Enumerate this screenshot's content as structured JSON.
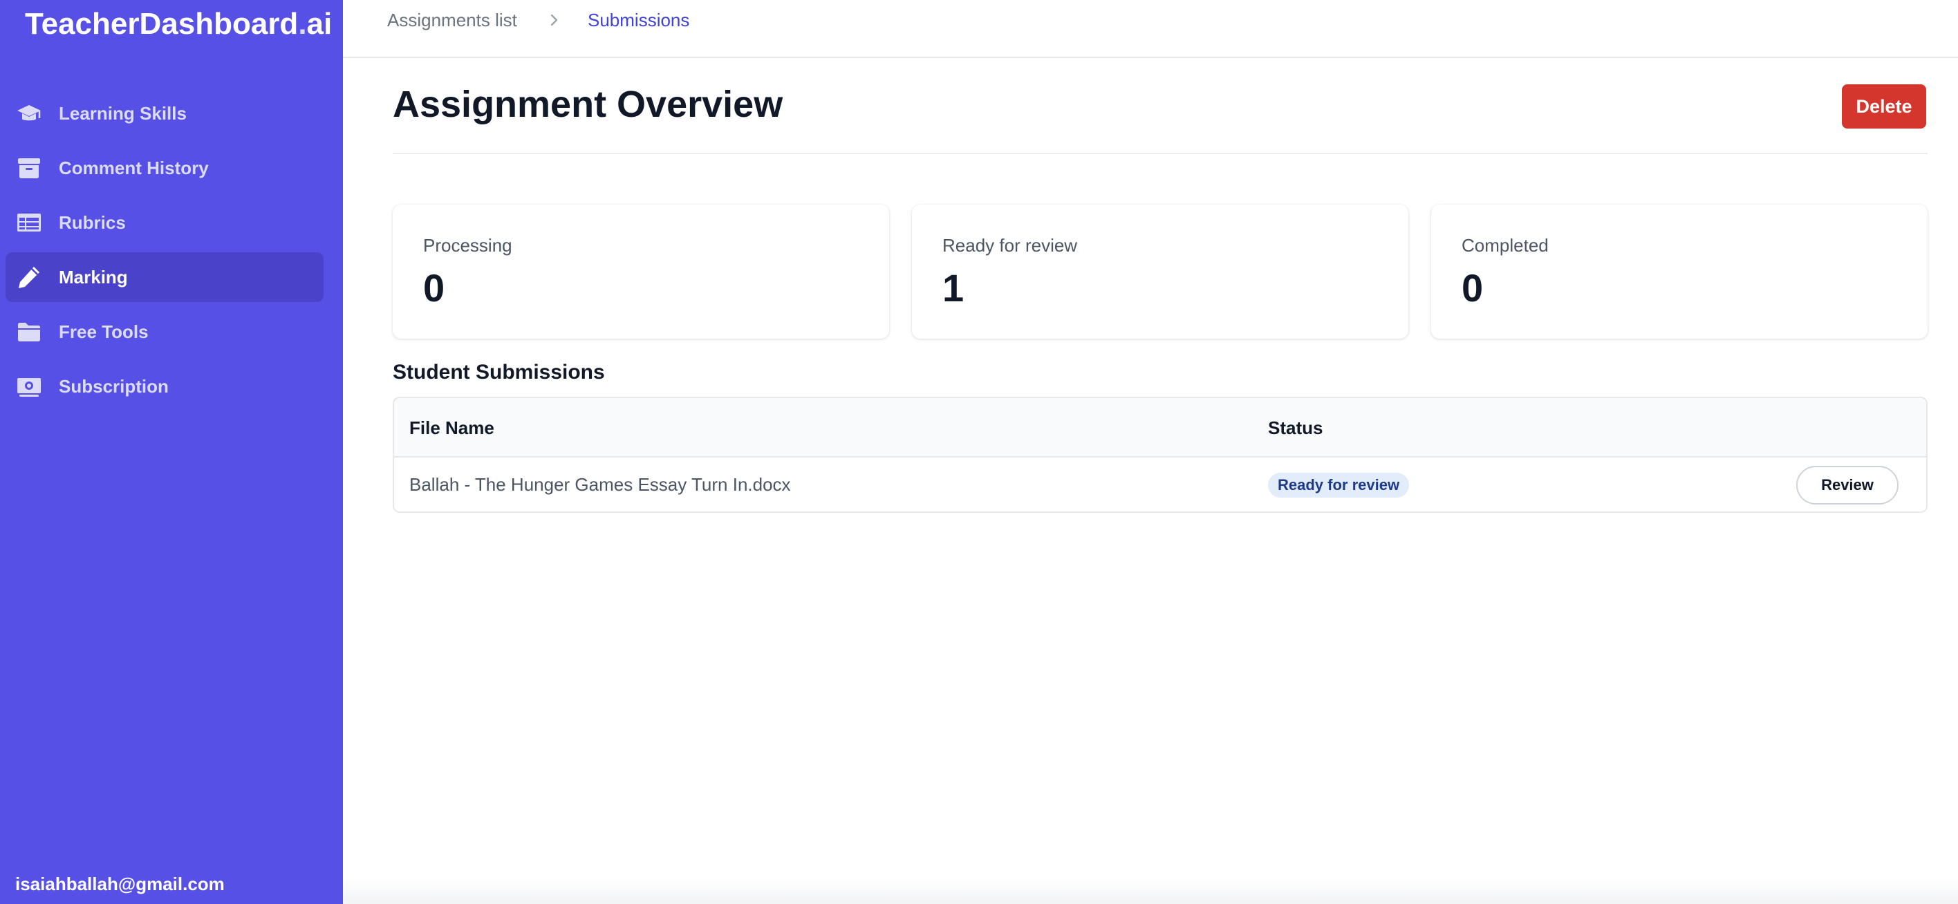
{
  "brand": {
    "name": "TeacherDashboard",
    "dot": ".",
    "suffix": "ai"
  },
  "sidebar": {
    "items": [
      {
        "label": "Learning Skills",
        "icon": "graduation-cap-icon",
        "active": false
      },
      {
        "label": "Comment History",
        "icon": "archive-box-icon",
        "active": false
      },
      {
        "label": "Rubrics",
        "icon": "table-icon",
        "active": false
      },
      {
        "label": "Marking",
        "icon": "pencil-icon",
        "active": true
      },
      {
        "label": "Free Tools",
        "icon": "folder-icon",
        "active": false
      },
      {
        "label": "Subscription",
        "icon": "banknote-icon",
        "active": false
      }
    ],
    "user_email": "isaiahballah@gmail.com"
  },
  "breadcrumb": {
    "first": "Assignments list",
    "current": "Submissions"
  },
  "main": {
    "title": "Assignment Overview",
    "delete_label": "Delete",
    "stats": [
      {
        "label": "Processing",
        "value": "0"
      },
      {
        "label": "Ready for review",
        "value": "1"
      },
      {
        "label": "Completed",
        "value": "0"
      }
    ],
    "submissions": {
      "title": "Student Submissions",
      "columns": {
        "file_name": "File Name",
        "status": "Status"
      },
      "rows": [
        {
          "file_name": "Ballah - The Hunger Games Essay Turn In.docx",
          "status": "Ready for review",
          "action": "Review"
        }
      ]
    }
  },
  "colors": {
    "sidebar": "#5750e6",
    "sidebar_active": "#4a42c9",
    "delete": "#d4362d",
    "breadcrumb_current": "#3f43d6",
    "badge_bg": "#e3ecfb",
    "badge_text": "#1e3a8a"
  }
}
